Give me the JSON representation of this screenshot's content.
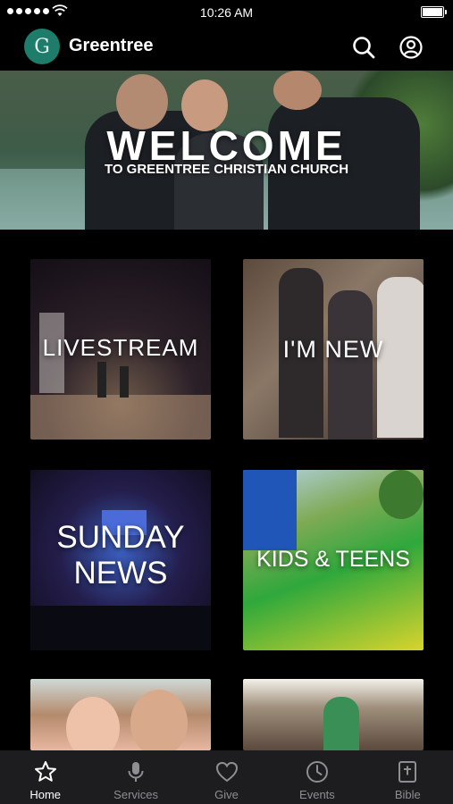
{
  "status_bar": {
    "time": "10:26 AM"
  },
  "header": {
    "title": "Greentree",
    "logo_letter": "G",
    "logo_color": "#1d7c6a"
  },
  "hero": {
    "title": "WELCOME",
    "subtitle": "TO GREENTREE CHRISTIAN CHURCH"
  },
  "tiles": [
    {
      "label": "LIVESTREAM"
    },
    {
      "label": "I'M NEW"
    },
    {
      "label_line1": "SUNDAY",
      "label_line2": "NEWS"
    },
    {
      "label": "KIDS & TEENS"
    }
  ],
  "tabbar": {
    "items": [
      {
        "label": "Home",
        "icon": "star-icon",
        "active": true
      },
      {
        "label": "Services",
        "icon": "microphone-icon"
      },
      {
        "label": "Give",
        "icon": "heart-icon"
      },
      {
        "label": "Events",
        "icon": "clock-icon"
      },
      {
        "label": "Bible",
        "icon": "bible-icon"
      }
    ]
  }
}
